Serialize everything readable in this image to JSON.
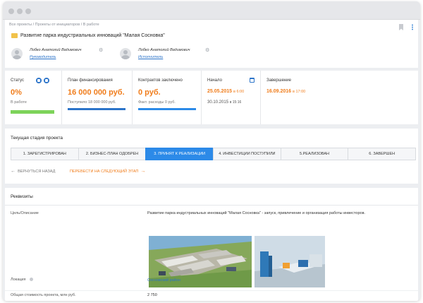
{
  "breadcrumb": "Все проекты / Проекты от инициаторов / В работе",
  "project_title": "Развитие парка индустриальных инноваций \"Малая Сосновка\"",
  "people": [
    {
      "name": "Лобко Анатолий Вадимович",
      "role": "Руководитель"
    },
    {
      "name": "Лобко Анатолий Вадимович",
      "role": "Исполнитель"
    }
  ],
  "stats": {
    "status": {
      "label": "Статус",
      "value": "0%",
      "sub": "В работе",
      "progress": 1.0
    },
    "financing": {
      "label": "План финансирования",
      "value": "16 000 000 руб.",
      "sub": "Поступило 18 000 000 руб.",
      "progress": 1.0
    },
    "contracts": {
      "label": "Контрактов заключено",
      "value": "0 руб.",
      "sub": "Факт. расходы 0 руб.",
      "progress": 1.0
    },
    "start": {
      "label": "Начало",
      "date": "25.05.2015",
      "time": "в 6:00",
      "date2": "30.10.2015",
      "time2": "в 15:16"
    },
    "end": {
      "label": "Завершение",
      "date": "16.09.2016",
      "time": "в 17:00"
    }
  },
  "colors": {
    "accent": "#f07d1c",
    "primary": "#2c8ae8",
    "success": "#7dd35a",
    "link": "#2c74c9"
  },
  "stage": {
    "title": "Текущая стадия проекта",
    "steps": [
      "1. ЗАРЕГИСТРИРОВАН",
      "2. БИЗНЕС-ПЛАН ОДОБРЕН",
      "3. ПРИНЯТ К РЕАЛИЗАЦИИ",
      "4. ИНВЕСТИЦИИ ПОСТУПИЛИ",
      "5.РЕАЛИЗОВАН",
      "6. ЗАВЕРШЕН"
    ],
    "active_index": 2,
    "back_label": "ВЕРНУТЬСЯ НАЗАД",
    "next_label": "ПЕРЕВЕСТИ НА СЛЕДУЮЩИЙ ЭТАП"
  },
  "props": {
    "title": "Реквизиты",
    "goal_label": "Цель/Описание",
    "goal_value": "Развитие парка индустриальных инноваций \"Малая Сосновка\" - запуск, привлечение и организация работы инвесторов.",
    "location_label": "Локация",
    "location_value": "Сосновский район",
    "cost_label": "Общая стоимость проекта, млн руб.",
    "cost_value": "2 750"
  }
}
